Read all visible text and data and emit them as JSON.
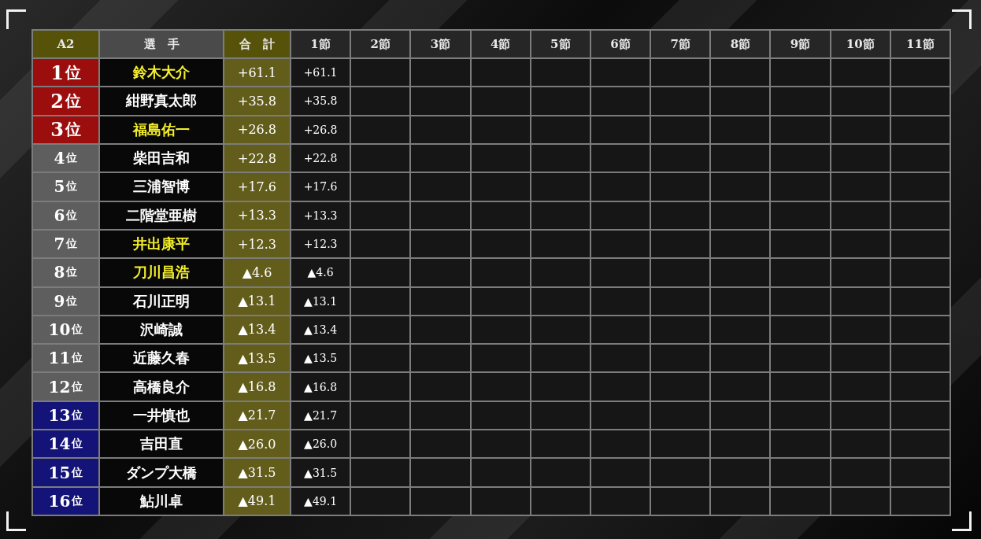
{
  "header": {
    "league": "A2",
    "player": "選　手",
    "total": "合　計",
    "rounds": [
      "1節",
      "2節",
      "3節",
      "4節",
      "5節",
      "6節",
      "7節",
      "8節",
      "9節",
      "10節",
      "11節"
    ]
  },
  "rows": [
    {
      "rank": "1",
      "unit": "位",
      "color": "#9c0d0d",
      "name": "鈴木大介",
      "highlighted": true,
      "total": "+61.1",
      "rounds": [
        "+61.1"
      ]
    },
    {
      "rank": "2",
      "unit": "位",
      "color": "#9c0d0d",
      "name": "紺野真太郎",
      "highlighted": false,
      "total": "+35.8",
      "rounds": [
        "+35.8"
      ]
    },
    {
      "rank": "3",
      "unit": "位",
      "color": "#9c0d0d",
      "name": "福島佑一",
      "highlighted": true,
      "total": "+26.8",
      "rounds": [
        "+26.8"
      ]
    },
    {
      "rank": "4",
      "unit": "位",
      "color": "#5e5e5e",
      "name": "柴田吉和",
      "highlighted": false,
      "total": "+22.8",
      "rounds": [
        "+22.8"
      ]
    },
    {
      "rank": "5",
      "unit": "位",
      "color": "#5e5e5e",
      "name": "三浦智博",
      "highlighted": false,
      "total": "+17.6",
      "rounds": [
        "+17.6"
      ]
    },
    {
      "rank": "6",
      "unit": "位",
      "color": "#5e5e5e",
      "name": "二階堂亜樹",
      "highlighted": false,
      "total": "+13.3",
      "rounds": [
        "+13.3"
      ]
    },
    {
      "rank": "7",
      "unit": "位",
      "color": "#5e5e5e",
      "name": "井出康平",
      "highlighted": true,
      "total": "+12.3",
      "rounds": [
        "+12.3"
      ]
    },
    {
      "rank": "8",
      "unit": "位",
      "color": "#5e5e5e",
      "name": "刀川昌浩",
      "highlighted": true,
      "total": "▲4.6",
      "rounds": [
        "▲4.6"
      ]
    },
    {
      "rank": "9",
      "unit": "位",
      "color": "#5e5e5e",
      "name": "石川正明",
      "highlighted": false,
      "total": "▲13.1",
      "rounds": [
        "▲13.1"
      ]
    },
    {
      "rank": "10",
      "unit": "位",
      "color": "#5e5e5e",
      "name": "沢崎誠",
      "highlighted": false,
      "total": "▲13.4",
      "rounds": [
        "▲13.4"
      ]
    },
    {
      "rank": "11",
      "unit": "位",
      "color": "#5e5e5e",
      "name": "近藤久春",
      "highlighted": false,
      "total": "▲13.5",
      "rounds": [
        "▲13.5"
      ]
    },
    {
      "rank": "12",
      "unit": "位",
      "color": "#5e5e5e",
      "name": "高橋良介",
      "highlighted": false,
      "total": "▲16.8",
      "rounds": [
        "▲16.8"
      ]
    },
    {
      "rank": "13",
      "unit": "位",
      "color": "#141478",
      "name": "一井慎也",
      "highlighted": false,
      "total": "▲21.7",
      "rounds": [
        "▲21.7"
      ]
    },
    {
      "rank": "14",
      "unit": "位",
      "color": "#141478",
      "name": "吉田直",
      "highlighted": false,
      "total": "▲26.0",
      "rounds": [
        "▲26.0"
      ]
    },
    {
      "rank": "15",
      "unit": "位",
      "color": "#141478",
      "name": "ダンプ大橋",
      "highlighted": false,
      "total": "▲31.5",
      "rounds": [
        "▲31.5"
      ]
    },
    {
      "rank": "16",
      "unit": "位",
      "color": "#141478",
      "name": "鮎川卓",
      "highlighted": false,
      "total": "▲49.1",
      "rounds": [
        "▲49.1"
      ]
    }
  ]
}
